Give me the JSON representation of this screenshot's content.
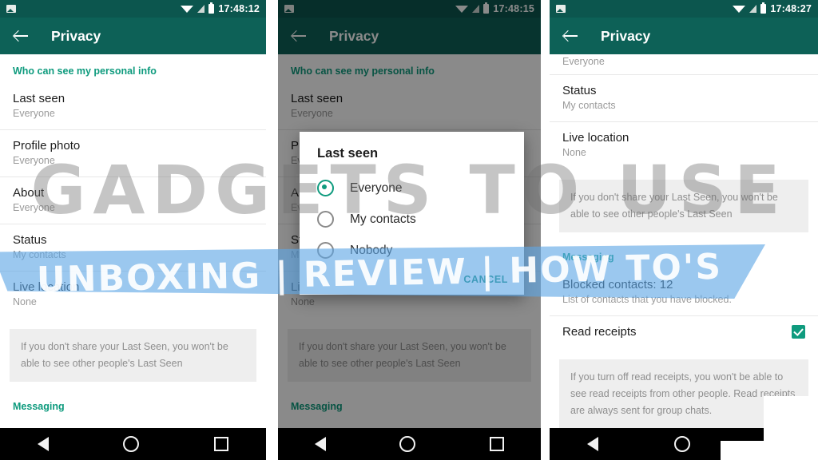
{
  "panels": [
    {
      "status": {
        "time": "17:48:12",
        "icons": [
          "photo-icon",
          "wifi-icon",
          "signal-icon",
          "battery-icon"
        ]
      },
      "appbar": {
        "back": "back-arrow-icon",
        "title": "Privacy"
      },
      "section_header": "Who can see my personal info",
      "rows": [
        {
          "title": "Last seen",
          "sub": "Everyone"
        },
        {
          "title": "Profile photo",
          "sub": "Everyone"
        },
        {
          "title": "About",
          "sub": "Everyone"
        },
        {
          "title": "Status",
          "sub": "My contacts"
        },
        {
          "title": "Live location",
          "sub": "None"
        }
      ],
      "note": "If you don't share your Last Seen, you won't be able to see other people's Last Seen",
      "messaging_header": "Messaging"
    },
    {
      "status": {
        "time": "17:48:15"
      },
      "appbar": {
        "title": "Privacy"
      },
      "section_header": "Who can see my personal info",
      "rows": [
        {
          "title": "Last seen",
          "sub": "Everyone"
        },
        {
          "title": "Profile photo",
          "sub": "Everyone"
        },
        {
          "title": "About",
          "sub": "Everyone"
        },
        {
          "title": "Status",
          "sub": "My contacts"
        },
        {
          "title": "Live location",
          "sub": "None"
        }
      ],
      "note": "If you don't share your Last Seen, you won't be able to see other people's Last Seen",
      "messaging_header": "Messaging",
      "dialog": {
        "title": "Last seen",
        "options": [
          {
            "label": "Everyone",
            "selected": true
          },
          {
            "label": "My contacts",
            "selected": false
          },
          {
            "label": "Nobody",
            "selected": false
          }
        ],
        "cancel": "CANCEL"
      }
    },
    {
      "status": {
        "time": "17:48:27"
      },
      "appbar": {
        "title": "Privacy"
      },
      "cut_row": "Everyone",
      "rows": [
        {
          "title": "Status",
          "sub": "My contacts"
        },
        {
          "title": "Live location",
          "sub": "None"
        }
      ],
      "note": "If you don't share your Last Seen, you won't be able to see other people's Last Seen",
      "messaging_header": "Messaging",
      "blocked": {
        "title": "Blocked contacts: 12",
        "sub": "List of contacts that you have blocked."
      },
      "read_receipts": {
        "title": "Read receipts",
        "checked": true
      },
      "note2": "If you turn off read receipts, you won't be able to see read receipts from other people. Read receipts are always sent for group chats."
    }
  ],
  "navbar": {
    "back": "nav-back-icon",
    "home": "nav-home-icon",
    "recents": "nav-recents-icon"
  },
  "watermark": {
    "brand": "GADGETS TO USE",
    "tagline": "UNBOXING | REVIEW | HOW TO'S"
  },
  "colors": {
    "header_green": "#0d6157",
    "statusbar_green": "#0c564e",
    "accent_teal": "#0f9b7e",
    "band_blue": "#5ea7e5"
  }
}
